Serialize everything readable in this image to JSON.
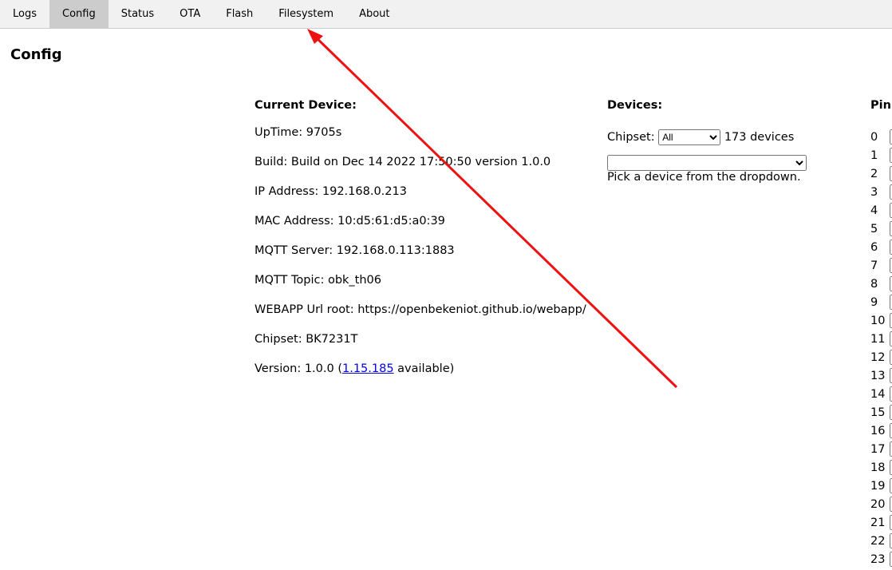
{
  "tabs": [
    "Logs",
    "Config",
    "Status",
    "OTA",
    "Flash",
    "Filesystem",
    "About"
  ],
  "active_tab": "Config",
  "page_title": "Config",
  "current_device": {
    "heading": "Current Device:",
    "rows": [
      "UpTime: 9705s",
      "Build: Build on Dec 14 2022 17:50:50 version 1.0.0",
      "IP Address: 192.168.0.213",
      "MAC Address: 10:d5:61:d5:a0:39",
      "MQTT Server: 192.168.0.113:1883",
      "MQTT Topic: obk_th06",
      "WEBAPP Url root: https://openbekeniot.github.io/webapp/",
      "Chipset: BK7231T"
    ],
    "version_prefix": "Version: 1.0.0 (",
    "version_link": "1.15.185",
    "version_suffix": " available)"
  },
  "devices": {
    "heading": "Devices:",
    "chipset_label": "Chipset:",
    "chipset_value": "All",
    "count": "173 devices",
    "device_value": "",
    "hint": "Pick a device from the dropdown."
  },
  "pins": {
    "heading": "Pin",
    "numbers": [
      "0",
      "1",
      "2",
      "3",
      "4",
      "5",
      "6",
      "7",
      "8",
      "9",
      "10",
      "11",
      "12",
      "13",
      "14",
      "15",
      "16",
      "17",
      "18",
      "19",
      "20",
      "21",
      "22",
      "23"
    ]
  },
  "annotation_color": "#ee1111"
}
